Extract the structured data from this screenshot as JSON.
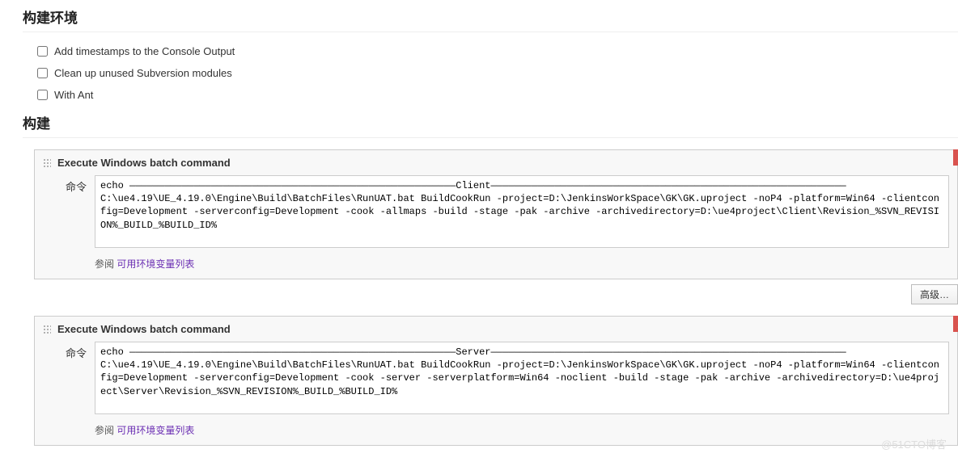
{
  "sections": {
    "env_title": "构建环境",
    "build_title": "构建"
  },
  "env_checks": [
    {
      "label": "Add timestamps to the Console Output"
    },
    {
      "label": "Clean up unused Subversion modules"
    },
    {
      "label": "With Ant"
    }
  ],
  "step_common": {
    "title": "Execute Windows batch command",
    "cmd_label": "命令",
    "help_prefix": "参阅 ",
    "help_link": "可用环境变量列表",
    "delete": "X",
    "advanced": "高级…"
  },
  "steps": [
    {
      "command": "echo ————————————————————————————————————————————————————————Client—————————————————————————————————————————————————————————————\nC:\\ue4.19\\UE_4.19.0\\Engine\\Build\\BatchFiles\\RunUAT.bat BuildCookRun -project=D:\\JenkinsWorkSpace\\GK\\GK.uproject -noP4 -platform=Win64 -clientconfig=Development -serverconfig=Development -cook -allmaps -build -stage -pak -archive -archivedirectory=D:\\ue4project\\Client\\Revision_%SVN_REVISION%_BUILD_%BUILD_ID%"
    },
    {
      "command": "echo ————————————————————————————————————————————————————————Server—————————————————————————————————————————————————————————————\nC:\\ue4.19\\UE_4.19.0\\Engine\\Build\\BatchFiles\\RunUAT.bat BuildCookRun -project=D:\\JenkinsWorkSpace\\GK\\GK.uproject -noP4 -platform=Win64 -clientconfig=Development -serverconfig=Development -cook -server -serverplatform=Win64 -noclient -build -stage -pak -archive -archivedirectory=D:\\ue4project\\Server\\Revision_%SVN_REVISION%_BUILD_%BUILD_ID%"
    }
  ],
  "watermark": "@51CTO博客"
}
